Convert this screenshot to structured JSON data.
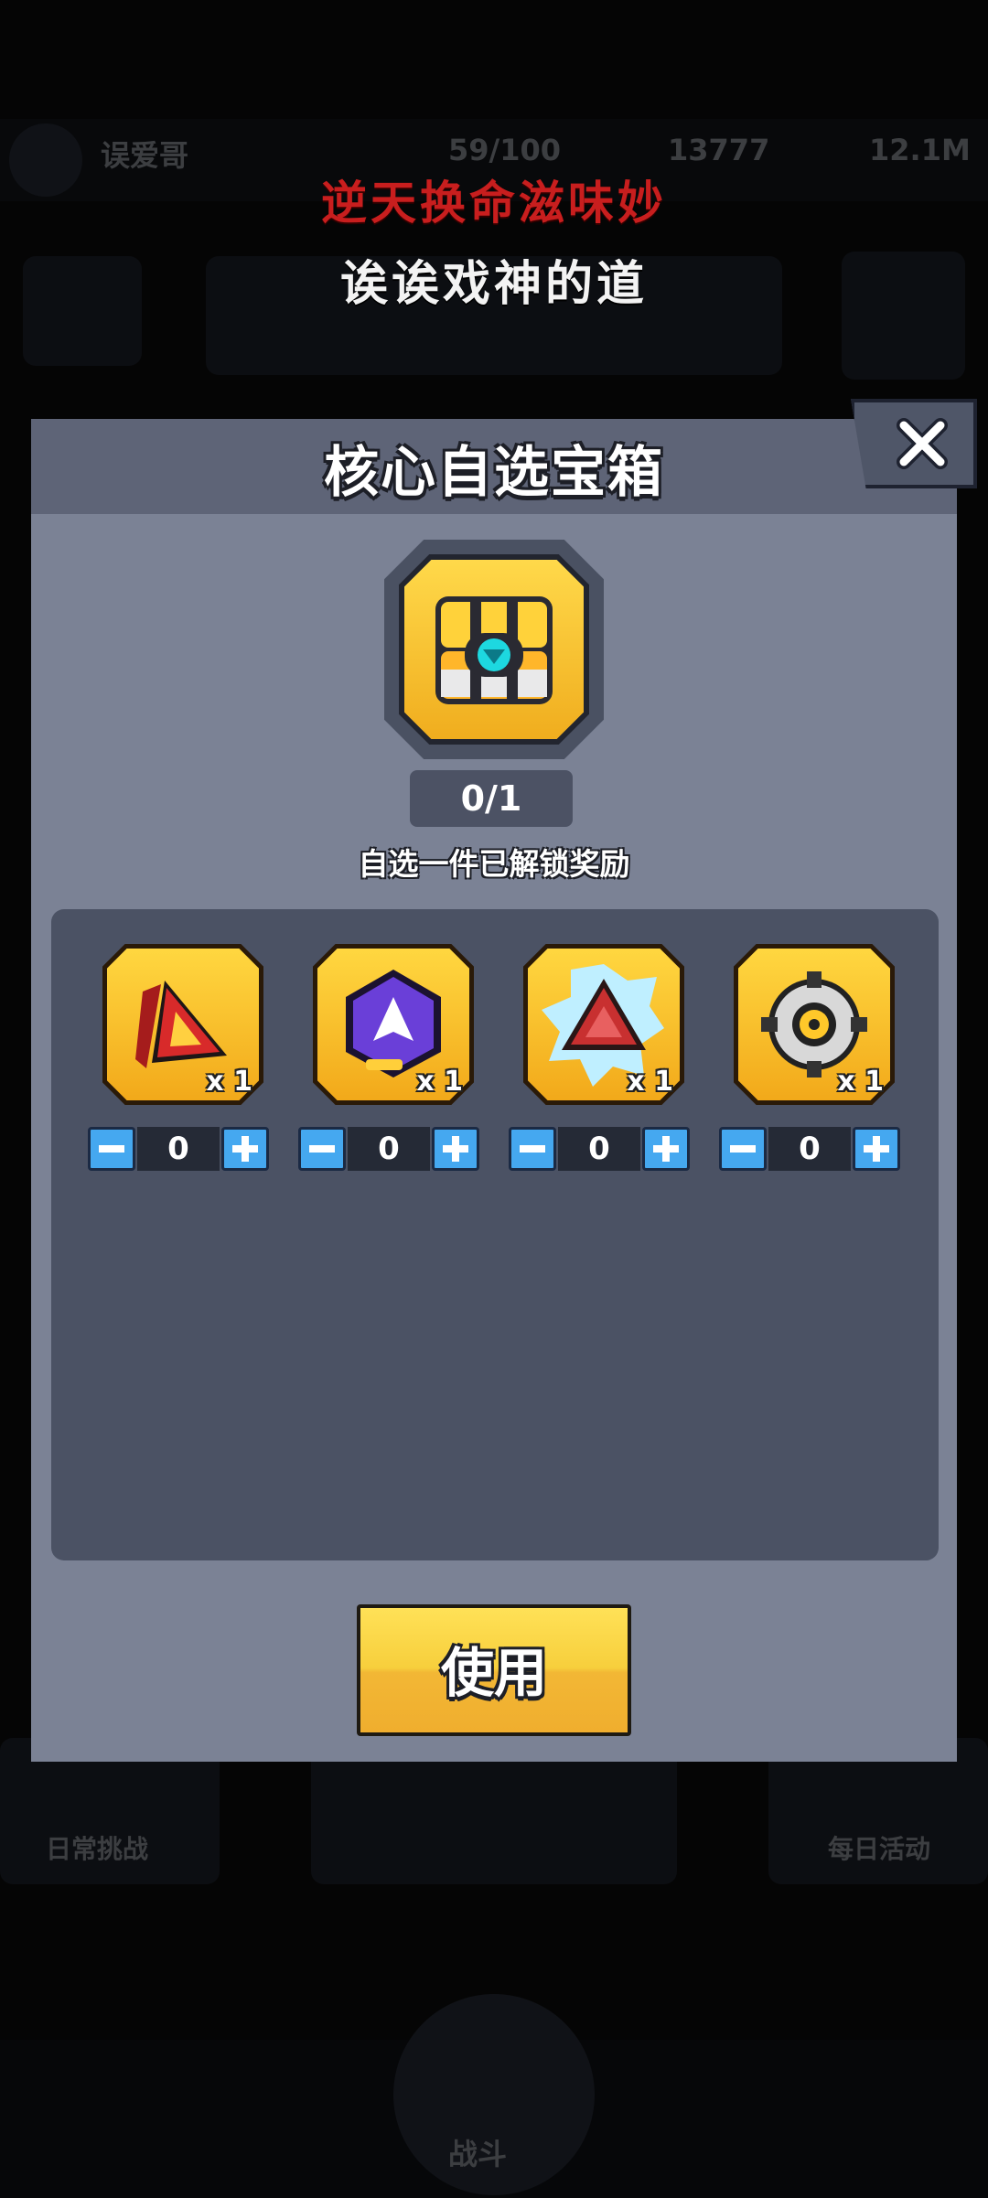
{
  "overlay": {
    "line1": "逆天换命滋味妙",
    "line2": "诶诶戏神的道"
  },
  "background": {
    "player_name": "误爱哥",
    "energy": "59/100",
    "coins": "13777",
    "gems": "12.1M",
    "left_bottom_label": "日常挑战",
    "right_bottom_label": "每日活动",
    "battle_label": "战斗"
  },
  "modal": {
    "title": "核心自选宝箱",
    "counter": "0/1",
    "subtitle": "自选一件已解锁奖励",
    "use_label": "使用",
    "close_icon": "close-icon"
  },
  "items": [
    {
      "name": "red-triangle-core",
      "qty": "x 1",
      "value": "0",
      "color": "#d82a2a"
    },
    {
      "name": "purple-crystal-core",
      "qty": "x 1",
      "value": "0",
      "color": "#6a3fd8"
    },
    {
      "name": "red-shield-core",
      "qty": "x 1",
      "value": "0",
      "color": "#c83030"
    },
    {
      "name": "gear-ring-core",
      "qty": "x 1",
      "value": "0",
      "color": "#9a9a9a"
    }
  ],
  "colors": {
    "modal_bg": "#7b8295",
    "header_bg": "#5e6477",
    "panel_bg": "#4b5264",
    "gold": "#f2b735",
    "stepper_blue": "#45a8f0",
    "title_red": "#c81e1e"
  }
}
